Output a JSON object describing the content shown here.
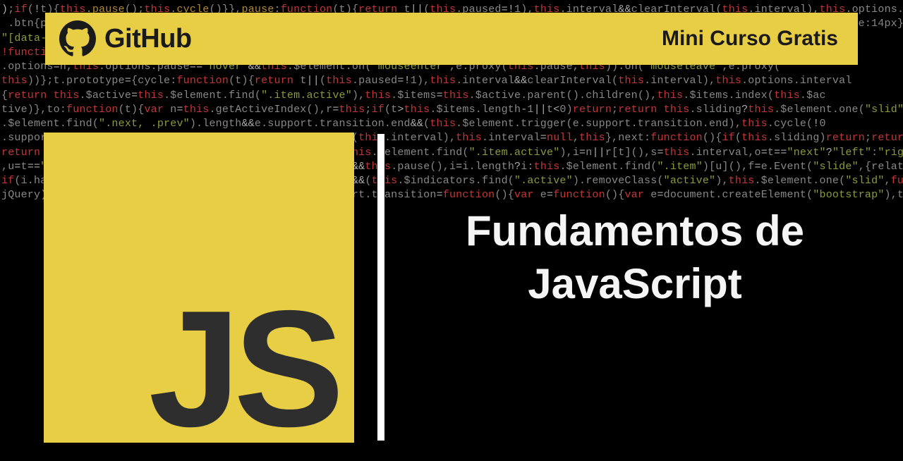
{
  "header": {
    "brand_name": "GitHub",
    "course_label": "Mini Curso Gratis"
  },
  "badge": {
    "logo_text": "JS"
  },
  "title": {
    "line1": "Fundamentos de",
    "line2": "JavaScript"
  },
  "colors": {
    "accent": "#e8ce44",
    "dark": "#1a1a1a",
    "text_light": "#f5f5f5"
  }
}
